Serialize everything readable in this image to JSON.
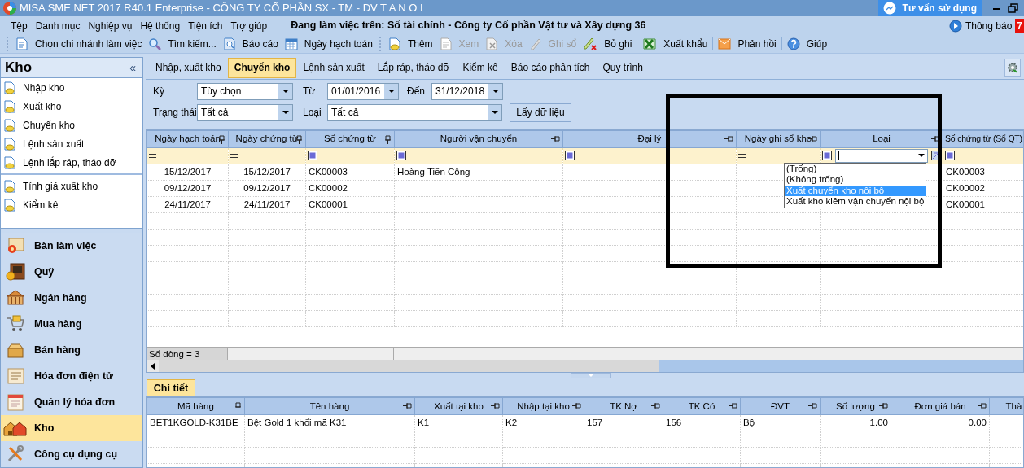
{
  "window": {
    "title": "MISA SME.NET 2017 R40.1 Enterprise - CÔNG TY CỔ PHẦN SX - TM - DV T A N O I"
  },
  "help_button": {
    "label": "Tư vấn sử dụng"
  },
  "menu": [
    "Tệp",
    "Danh mục",
    "Nghiệp vụ",
    "Hệ thống",
    "Tiện ích",
    "Trợ giúp"
  ],
  "workspace_notice": "Đang làm việc trên: Sổ tài chính - Công ty Cổ phần Vật tư và Xây dựng 36",
  "notifications": {
    "label": "Thông báo",
    "count": "7"
  },
  "toolbar_groups": [
    {
      "items": [
        {
          "label": "Chọn chi nhánh làm việc",
          "disabled": false
        },
        {
          "label": "Tìm kiếm...",
          "disabled": false
        },
        {
          "label": "Báo cáo",
          "disabled": false
        },
        {
          "label": "Ngày hạch toán",
          "disabled": false
        }
      ]
    },
    {
      "items": [
        {
          "label": "Thêm",
          "disabled": false
        },
        {
          "label": "Xem",
          "disabled": true
        },
        {
          "label": "Xóa",
          "disabled": true
        },
        {
          "label": "Ghi sổ",
          "disabled": true
        },
        {
          "label": "Bỏ ghi",
          "disabled": false
        }
      ]
    },
    {
      "items": [
        {
          "label": "Xuất khẩu",
          "disabled": false
        }
      ]
    },
    {
      "items": [
        {
          "label": "Phản hồi",
          "disabled": false
        }
      ]
    },
    {
      "items": [
        {
          "label": "Giúp",
          "disabled": false
        }
      ]
    }
  ],
  "sidebar": {
    "title": "Kho",
    "collapse_label": "«",
    "sections": [
      {
        "items": [
          "Nhập kho",
          "Xuất kho",
          "Chuyển kho",
          "Lệnh sản xuất",
          "Lệnh lắp ráp, tháo dỡ"
        ]
      },
      {
        "items": [
          "Tính giá xuất kho",
          "Kiểm kê"
        ]
      }
    ]
  },
  "modules": [
    {
      "label": "Bàn làm việc",
      "selected": false
    },
    {
      "label": "Quỹ",
      "selected": false
    },
    {
      "label": "Ngân hàng",
      "selected": false
    },
    {
      "label": "Mua hàng",
      "selected": false
    },
    {
      "label": "Bán hàng",
      "selected": false
    },
    {
      "label": "Hóa đơn điện tử",
      "selected": false
    },
    {
      "label": "Quản lý hóa đơn",
      "selected": false
    },
    {
      "label": "Kho",
      "selected": true
    },
    {
      "label": "Công cụ dụng cụ",
      "selected": false
    }
  ],
  "tabs": [
    {
      "label": "Nhập, xuất kho",
      "selected": false
    },
    {
      "label": "Chuyển kho",
      "selected": true
    },
    {
      "label": "Lệnh sản xuất",
      "selected": false
    },
    {
      "label": "Lắp ráp, tháo dỡ",
      "selected": false
    },
    {
      "label": "Kiểm kê",
      "selected": false
    },
    {
      "label": "Báo cáo phân tích",
      "selected": false
    },
    {
      "label": "Quy trình",
      "selected": false
    }
  ],
  "filters": {
    "period": {
      "label": "Kỳ",
      "value": "Tùy chọn"
    },
    "from": {
      "label": "Từ",
      "value": "01/01/2016"
    },
    "to": {
      "label": "Đến",
      "value": "31/12/2018"
    },
    "status": {
      "label": "Trạng thái",
      "value": "Tất cả"
    },
    "type": {
      "label": "Loại",
      "value": "Tất cả"
    },
    "fetch_button": "Lấy dữ liệu"
  },
  "grid": {
    "columns": [
      {
        "label": "Ngày hạch toán",
        "kind": "date",
        "pinned": true
      },
      {
        "label": "Ngày chứng từ",
        "kind": "date",
        "pinned": true
      },
      {
        "label": "Số chứng từ",
        "kind": "text",
        "pinned": true
      },
      {
        "label": "Người vận chuyển",
        "kind": "text",
        "pinned": false
      },
      {
        "label": "Đại lý",
        "kind": "text",
        "pinned": false
      },
      {
        "label": "Ngày ghi sổ kho",
        "kind": "date",
        "pinned": false
      },
      {
        "label": "Loại",
        "kind": "text",
        "pinned": false
      },
      {
        "label": "Số chứng từ (Sổ QT)",
        "kind": "text"
      }
    ],
    "filter_row": [
      {
        "kind": "equals"
      },
      {
        "kind": "equals"
      },
      {
        "kind": "contains"
      },
      {
        "kind": "contains"
      },
      {
        "kind": "contains"
      },
      {
        "kind": "equals"
      },
      {
        "kind": "list"
      },
      {
        "kind": "contains"
      }
    ],
    "rows": [
      [
        "15/12/2017",
        "15/12/2017",
        "CK00003",
        "Hoàng Tiến Công",
        "",
        "",
        "",
        "CK00003"
      ],
      [
        "09/12/2017",
        "09/12/2017",
        "CK00002",
        "",
        "",
        "",
        "",
        "CK00002"
      ],
      [
        "24/11/2017",
        "24/11/2017",
        "CK00001",
        "",
        "",
        "",
        "",
        "CK00001"
      ]
    ],
    "row_count": "Số dòng = 3",
    "dropdown_options": [
      {
        "label": "(Trống)",
        "selected": false
      },
      {
        "label": "(Không trống)",
        "selected": false
      },
      {
        "label": "Xuất chuyển kho nội bộ",
        "selected": true
      },
      {
        "label": "Xuất kho kiêm vận chuyển nội bộ",
        "selected": false
      }
    ]
  },
  "annotation": {
    "kind": "frame"
  },
  "detail": {
    "tab": "Chi tiết",
    "columns": [
      {
        "label": "Mã hàng",
        "kind": "text",
        "pinned": true
      },
      {
        "label": "Tên hàng",
        "kind": "text",
        "pinned": false
      },
      {
        "label": "Xuất tại kho",
        "kind": "text",
        "pinned": false
      },
      {
        "label": "Nhập tại kho",
        "kind": "text",
        "pinned": false
      },
      {
        "label": "TK Nợ",
        "kind": "text",
        "pinned": false
      },
      {
        "label": "TK Có",
        "kind": "text",
        "pinned": false
      },
      {
        "label": "ĐVT",
        "kind": "text",
        "pinned": false
      },
      {
        "label": "Số lượng",
        "kind": "number",
        "pinned": false
      },
      {
        "label": "Đơn giá bán",
        "kind": "number",
        "pinned": false
      },
      {
        "label": "Thà",
        "kind": "text"
      }
    ],
    "rows": [
      [
        "BET1KGOLD-K31BE",
        "Bệt Gold 1 khối mã K31",
        "K1",
        "K2",
        "157",
        "156",
        "Bộ",
        "1.00",
        "0.00",
        ""
      ]
    ]
  }
}
